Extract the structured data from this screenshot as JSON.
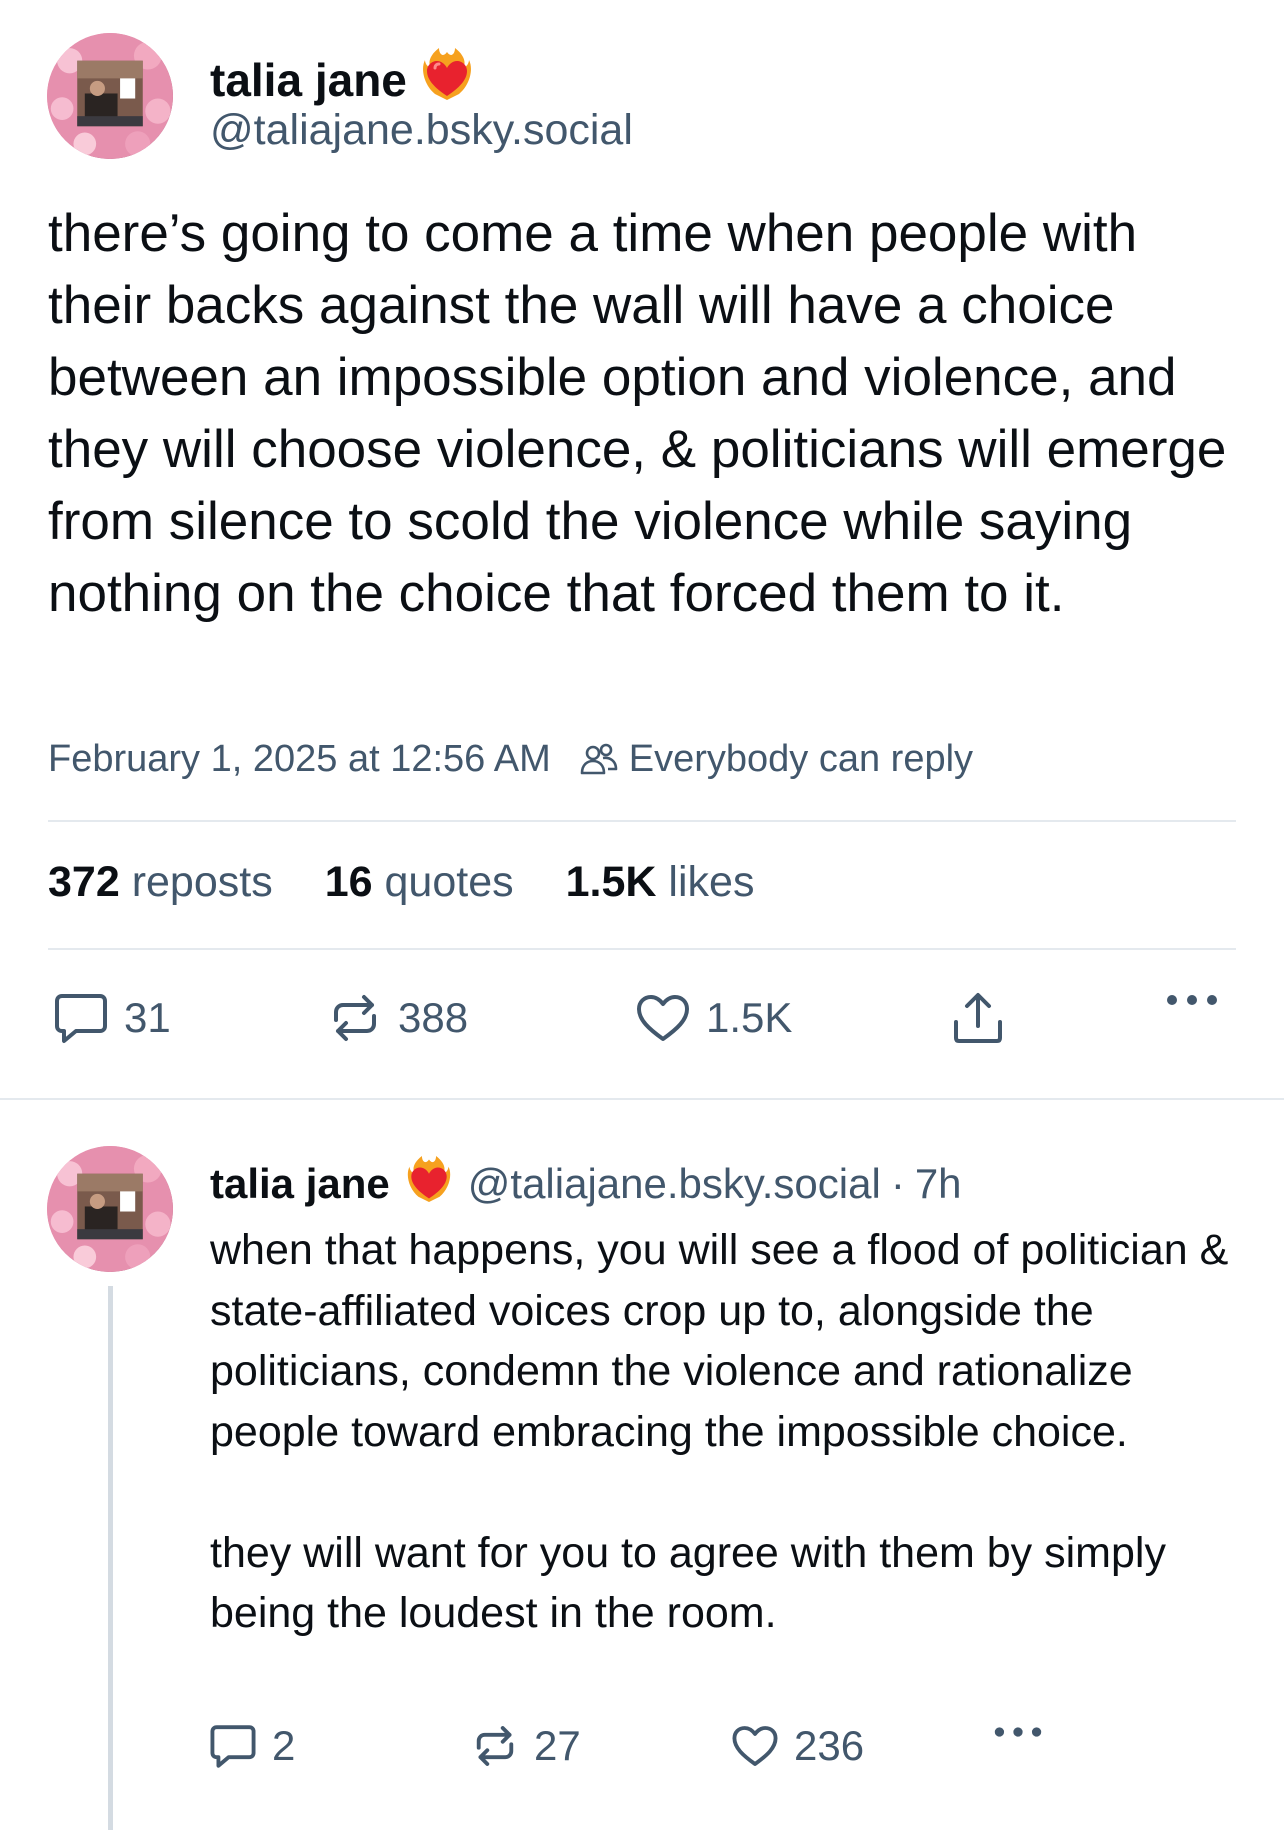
{
  "main_post": {
    "author_name": "talia jane",
    "author_handle": "@taliajane.bsky.social",
    "badge_icon": "heart-on-fire-emoji",
    "text": "there’s going to come a time when people with their backs against the wall will have a choice between an impossible option and violence, and they will choose violence, & politicians will emerge from silence to scold the violence while saying nothing on the choice that forced them to it.",
    "timestamp": "February 1, 2025 at 12:56 AM",
    "reply_setting": "Everybody can reply",
    "stats": {
      "reposts_count": "372",
      "reposts_label": "reposts",
      "quotes_count": "16",
      "quotes_label": "quotes",
      "likes_count": "1.5K",
      "likes_label": "likes"
    },
    "actions": {
      "replies": "31",
      "reposts": "388",
      "likes": "1.5K"
    }
  },
  "reply_post": {
    "author_name": "talia jane",
    "author_handle": "@taliajane.bsky.social",
    "separator": "·",
    "time_ago": "7h",
    "text": "when that happens, you will see a flood of politician & state-affiliated voices crop up to, alongside the politicians, condemn the violence and rationalize people toward embracing the impossible choice.\n\nthey will want for you to agree with them by simply being the loudest in the room.",
    "actions": {
      "replies": "2",
      "reposts": "27",
      "likes": "236"
    }
  },
  "colors": {
    "text_primary": "#0b0f14",
    "text_secondary": "#42576c",
    "divider": "#e4e9ee",
    "thread_line": "#d4dbe2"
  }
}
